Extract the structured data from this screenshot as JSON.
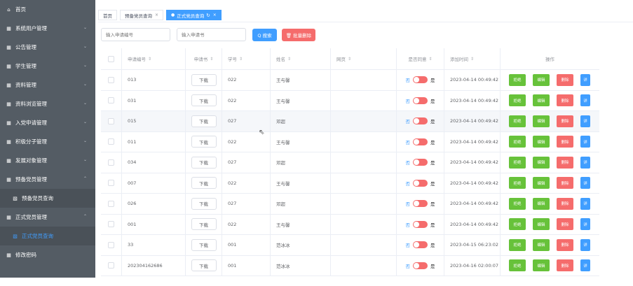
{
  "sidebar": {
    "items": [
      {
        "icon": "home-icon",
        "glyph": "⌂",
        "label": "首页",
        "chevron": ""
      },
      {
        "icon": "grid-icon",
        "glyph": "▦",
        "label": "系统用户管理",
        "chevron": "⌄"
      },
      {
        "icon": "grid-icon",
        "glyph": "▦",
        "label": "公告管理",
        "chevron": "⌄"
      },
      {
        "icon": "grid-icon",
        "glyph": "▦",
        "label": "学生管理",
        "chevron": "⌄"
      },
      {
        "icon": "grid-icon",
        "glyph": "▦",
        "label": "资料管理",
        "chevron": "⌄"
      },
      {
        "icon": "grid-icon",
        "glyph": "▦",
        "label": "资料浏览管理",
        "chevron": "⌄"
      },
      {
        "icon": "grid-icon",
        "glyph": "▦",
        "label": "入党申请管理",
        "chevron": "⌄"
      },
      {
        "icon": "grid-icon",
        "glyph": "▦",
        "label": "积极分子管理",
        "chevron": "⌄"
      },
      {
        "icon": "grid-icon",
        "glyph": "▦",
        "label": "发展对象管理",
        "chevron": "⌄"
      },
      {
        "icon": "grid-icon",
        "glyph": "▦",
        "label": "预备党员管理",
        "chevron": "⌃"
      },
      {
        "icon": "grid-icon",
        "glyph": "▧",
        "label": "预备党员查询",
        "chevron": "",
        "sub": true
      },
      {
        "icon": "grid-icon",
        "glyph": "▦",
        "label": "正式党员管理",
        "chevron": "⌃"
      },
      {
        "icon": "grid-icon",
        "glyph": "▧",
        "label": "正式党员查询",
        "chevron": "",
        "sub": true,
        "active": true
      },
      {
        "icon": "grid-icon",
        "glyph": "▦",
        "label": "修改密码",
        "chevron": ""
      }
    ]
  },
  "tabs": {
    "home": "首页",
    "prep": "预备党员查询",
    "prep_close": "×",
    "formal": "正式党员查询",
    "formal_dot": "●",
    "formal_refresh": "↻",
    "formal_close": "×"
  },
  "toolbar": {
    "app_no_placeholder": "输入申请编号",
    "book_placeholder": "输入申请书",
    "search_label": "Q 搜索",
    "bulk_delete_label": "🗑 批量删除"
  },
  "table": {
    "headers": {
      "app_no": "申请编号",
      "book": "申请书",
      "student_no": "学号",
      "name": "姓名",
      "remark": "网页",
      "agree": "是否同意",
      "time": "添加时间",
      "ops": "操作"
    },
    "sort_glyph": "⇕",
    "download_label": "下载",
    "switch_no": "否",
    "switch_yes": "是",
    "ops": {
      "reject": "拒绝",
      "edit": "编辑",
      "delete": "删除",
      "detail": "详"
    },
    "rows": [
      {
        "app_no": "013",
        "student_no": "022",
        "name": "王与馨",
        "time": "2023-04-14 00:49:42"
      },
      {
        "app_no": "031",
        "student_no": "022",
        "name": "王与馨",
        "time": "2023-04-14 00:49:42"
      },
      {
        "app_no": "015",
        "student_no": "027",
        "name": "邓超",
        "time": "2023-04-14 00:49:42"
      },
      {
        "app_no": "011",
        "student_no": "022",
        "name": "王与馨",
        "time": "2023-04-14 00:49:42"
      },
      {
        "app_no": "034",
        "student_no": "027",
        "name": "邓超",
        "time": "2023-04-14 00:49:42"
      },
      {
        "app_no": "007",
        "student_no": "022",
        "name": "王与馨",
        "time": "2023-04-14 00:49:42"
      },
      {
        "app_no": "026",
        "student_no": "027",
        "name": "邓超",
        "time": "2023-04-14 00:49:42"
      },
      {
        "app_no": "001",
        "student_no": "022",
        "name": "王与馨",
        "time": "2023-04-14 00:49:42"
      },
      {
        "app_no": "33",
        "student_no": "001",
        "name": "范冰冰",
        "time": "2023-04-15 06:23:02"
      },
      {
        "app_no": "202304162686",
        "student_no": "001",
        "name": "范冰冰",
        "time": "2023-04-16 02:00:07"
      }
    ]
  }
}
